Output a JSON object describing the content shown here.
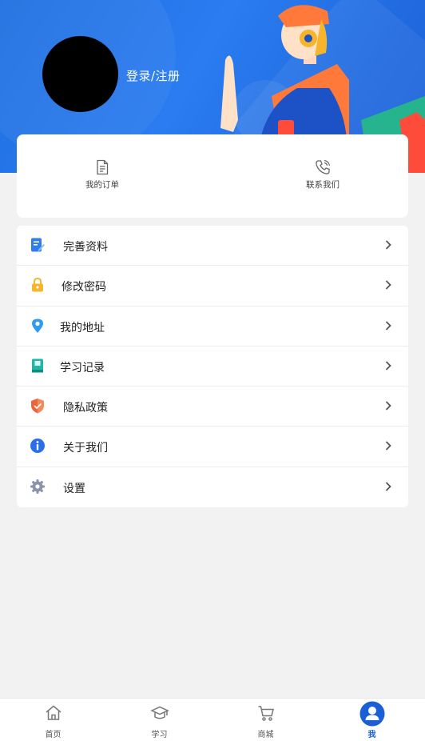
{
  "header": {
    "login_label": "登录/注册"
  },
  "quick_actions": [
    {
      "label": "我的订单",
      "icon": "order-document-icon"
    },
    {
      "label": "联系我们",
      "icon": "phone-icon"
    }
  ],
  "menu": [
    {
      "label": "完善资料",
      "icon": "edit-profile-icon",
      "color": "#2f7bf0"
    },
    {
      "label": "修改密码",
      "icon": "lock-icon",
      "color": "#f6b52a"
    },
    {
      "label": "我的地址",
      "icon": "location-pin-icon",
      "color": "#2f9cf0"
    },
    {
      "label": "学习记录",
      "icon": "book-icon",
      "color": "#1fb7a8"
    },
    {
      "label": "隐私政策",
      "icon": "shield-icon",
      "color": "#f0633a"
    },
    {
      "label": "关于我们",
      "icon": "info-icon",
      "color": "#2a6fe8"
    },
    {
      "label": "设置",
      "icon": "gear-icon",
      "color": "#8a93ad"
    }
  ],
  "tabbar": [
    {
      "label": "首页",
      "icon": "home-icon",
      "active": false
    },
    {
      "label": "学习",
      "icon": "graduation-cap-icon",
      "active": false
    },
    {
      "label": "商城",
      "icon": "cart-icon",
      "active": false
    },
    {
      "label": "我",
      "icon": "user-icon",
      "active": true
    }
  ],
  "colors": {
    "brand": "#1f6fe0",
    "active_tab": "#1a5fd6"
  }
}
